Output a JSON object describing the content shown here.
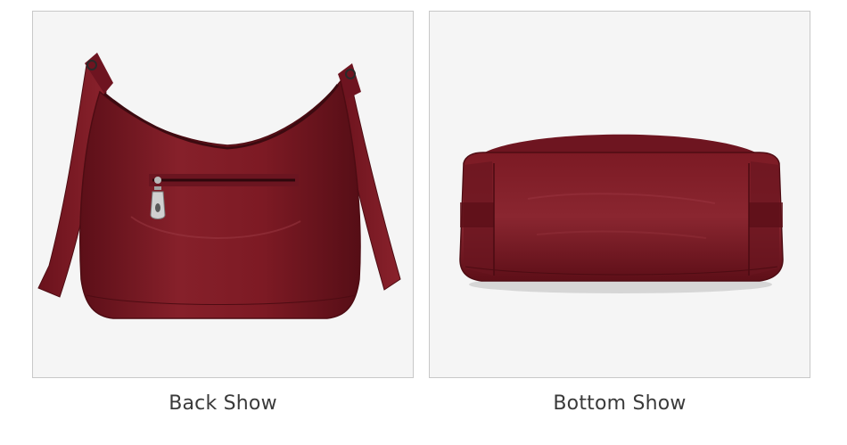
{
  "panels": [
    {
      "caption": "Back Show"
    },
    {
      "caption": "Bottom Show"
    }
  ],
  "colors": {
    "leather": "#7a1620",
    "leather_dark": "#4e0c13",
    "background": "#f5f5f5",
    "caption": "#3a3a3a"
  }
}
